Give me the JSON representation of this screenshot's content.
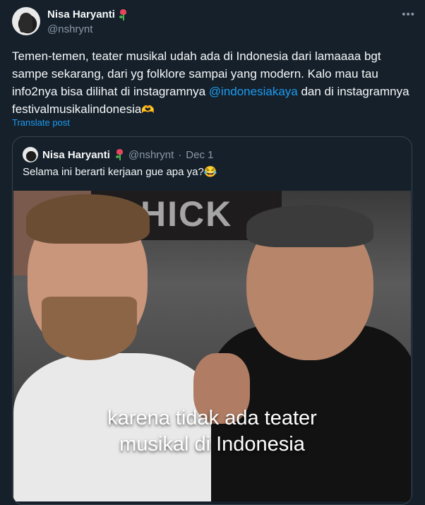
{
  "post": {
    "display_name": "Nisa Haryanti",
    "name_emoji": "rose",
    "handle": "@nshrynt",
    "more_icon": "more-horizontal-icon",
    "text_part1": "Temen-temen, teater musikal udah ada di Indonesia dari lamaaaa bgt sampe sekarang, dari yg folklore sampai yang modern. Kalo mau tau info2nya bisa dilihat di instagramnya ",
    "mention": "@indonesiakaya",
    "text_part2": " dan di instagramnya festivalmusikalindonesia",
    "text_emoji": "🫶",
    "translate_label": "Translate post"
  },
  "quote": {
    "display_name": "Nisa Haryanti",
    "handle": "@nshrynt",
    "separator": "·",
    "date": "Dec 1",
    "text": "Selama ini berarti kerjaan gue apa ya?",
    "text_emoji": "😂",
    "media": {
      "sign_letters": "HICK",
      "caption_line1": "karena tidak ada teater",
      "caption_line2": "musikal di Indonesia"
    }
  },
  "colors": {
    "background": "#15202b",
    "text": "#f7f9f9",
    "secondary": "#8b98a5",
    "accent": "#1d9bf0",
    "border": "#38444d"
  }
}
